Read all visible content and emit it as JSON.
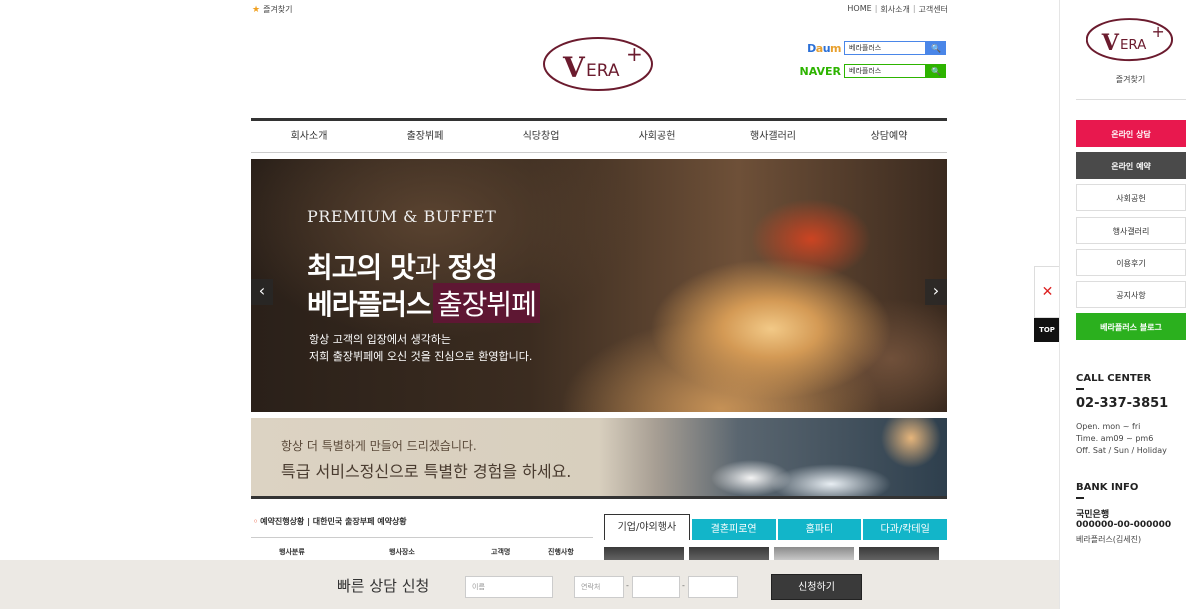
{
  "top": {
    "favorite_label": "즐겨찾기",
    "links": [
      "HOME",
      "회사소개",
      "고객센터"
    ]
  },
  "logo": {
    "text": "VERA+",
    "brand_color": "#6b1b2e"
  },
  "portals": {
    "daum": {
      "logo": "Daum",
      "query": "베라플러스"
    },
    "naver": {
      "logo": "NAVER",
      "query": "베라플러스"
    }
  },
  "gnb": [
    "회사소개",
    "출장뷔페",
    "식당창업",
    "사회공헌",
    "행사갤러리",
    "상담예약"
  ],
  "hero": {
    "subtitle": "PREMIUM & BUFFET",
    "line1_a": "최고의 맛",
    "line1_b": "과 ",
    "line1_c": "정성",
    "line2_a": "베라플러스",
    "line2_b": "출장뷔페",
    "desc1": "항상 고객의 입장에서 생각하는",
    "desc2": "저희 출장뷔페에 오신 것을 진심으로 환영합니다.",
    "prev": "‹",
    "next": "›"
  },
  "banner2": {
    "line1": "항상 더 특별하게 만들어 드리겠습니다.",
    "line2": "특급 서비스정신으로 특별한 경험을 하세요."
  },
  "reservation": {
    "title": "예약진행상황 | 대한민국 출장부페 예약상황",
    "columns": [
      "행사분류",
      "행사장소",
      "고객명",
      "진행사항"
    ]
  },
  "tabs": [
    "기업/야외행사",
    "결혼피로연",
    "홈파티",
    "다과/칵테일"
  ],
  "quick": {
    "title": "빠른 상담 신청",
    "name_placeholder": "이름",
    "phone_placeholder": "연락처",
    "dash": "-",
    "submit": "신청하기"
  },
  "float": {
    "close": "✕",
    "top": "TOP"
  },
  "sidebar": {
    "favorite": "즐겨찾기",
    "buttons": [
      "온라인 상담",
      "온라인 예약",
      "사회공헌",
      "행사갤러리",
      "이용후기",
      "공지사항",
      "베라플러스 블로그"
    ],
    "call_center": {
      "title": "CALL CENTER",
      "phone": "02-337-3851",
      "open": "Open. mon ~ fri",
      "time": "Time. am09 ~ pm6",
      "off": "Off. Sat / Sun / Holiday"
    },
    "bank": {
      "title": "BANK INFO",
      "name": "국민은행",
      "account": "000000-00-000000",
      "holder": "베라플러스(김세진)"
    }
  }
}
